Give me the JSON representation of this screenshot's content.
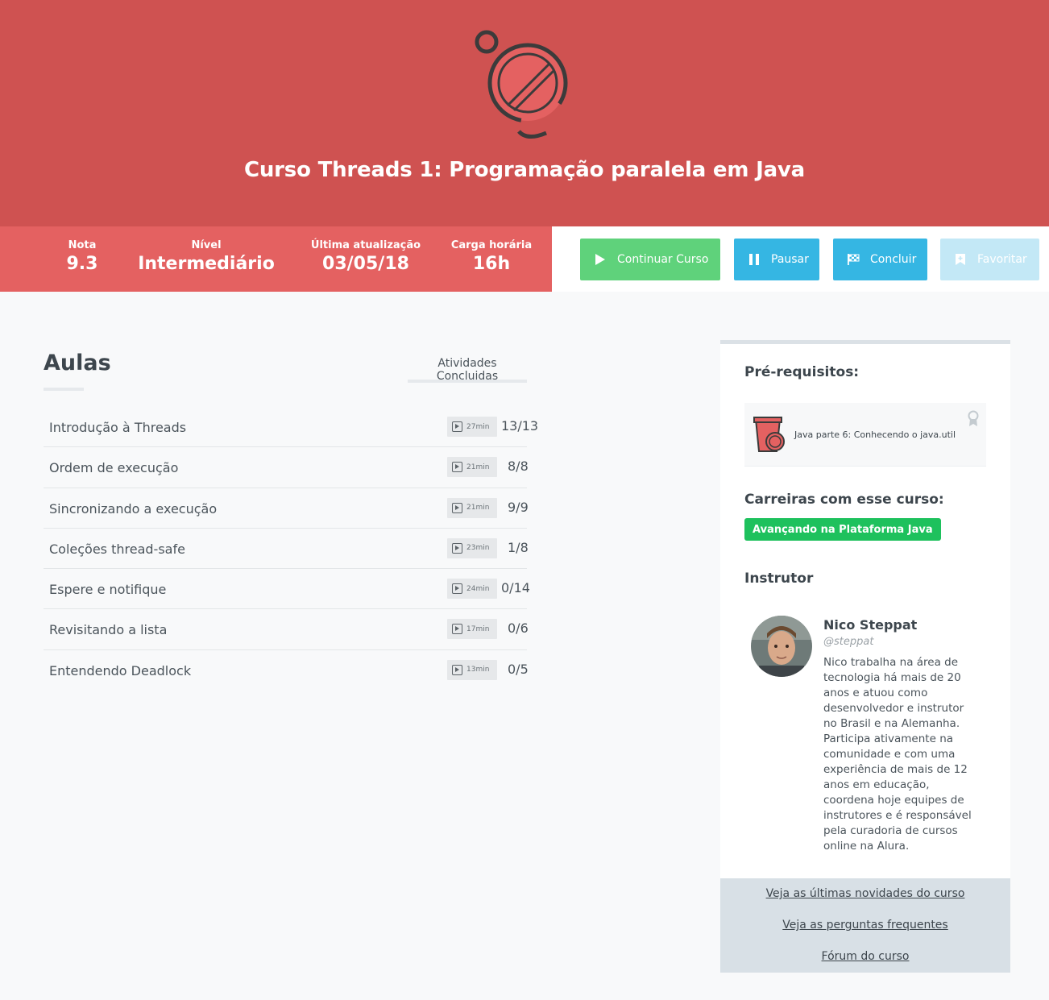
{
  "header": {
    "title": "Curso Threads 1: Programação paralela em Java",
    "logo_icon": "course-threads-icon"
  },
  "stats": {
    "nota": {
      "label": "Nota",
      "value": "9.3"
    },
    "nivel": {
      "label": "Nível",
      "value": "Intermediário"
    },
    "ultima": {
      "label": "Última atualização",
      "value": "03/05/18"
    },
    "carga": {
      "label": "Carga horária",
      "value": "16h"
    }
  },
  "actions": {
    "continuar": "Continuar Curso",
    "pausar": "Pausar",
    "concluir": "Concluir",
    "favoritar": "Favoritar"
  },
  "aulas": {
    "title": "Aulas",
    "activities_label": "Atividades Concluidas",
    "lessons": [
      {
        "name": "Introdução à Threads",
        "duration": "27min",
        "progress": "13/13"
      },
      {
        "name": "Ordem de execução",
        "duration": "21min",
        "progress": "8/8"
      },
      {
        "name": "Sincronizando a execução",
        "duration": "21min",
        "progress": "9/9"
      },
      {
        "name": "Coleções thread-safe",
        "duration": "23min",
        "progress": "1/8"
      },
      {
        "name": "Espere e notifique",
        "duration": "24min",
        "progress": "0/14"
      },
      {
        "name": "Revisitando a lista",
        "duration": "17min",
        "progress": "0/6"
      },
      {
        "name": "Entendendo Deadlock",
        "duration": "13min",
        "progress": "0/5"
      }
    ]
  },
  "sidebar": {
    "prereq_title": "Pré-requisitos:",
    "prereq_course": "Java parte 6: Conhecendo o java.util",
    "careers_title": "Carreiras com esse curso:",
    "career": "Avançando na Plataforma Java",
    "instructor_title": "Instrutor",
    "instructor": {
      "name": "Nico Steppat",
      "handle": "@steppat",
      "bio_lines": [
        "Nico trabalha na área de",
        "tecnologia há mais de 20",
        "anos e atuou como",
        "desenvolvedor e instrutor",
        "no Brasil e na Alemanha.",
        "Participa ativamente na",
        "comunidade e com uma",
        "experiência de mais de 12",
        "anos em educação,",
        "coordena hoje equipes de",
        "instrutores e é responsável",
        "pela curadoria de cursos",
        "online na Alura."
      ]
    },
    "links": [
      "Veja as últimas novidades do curso",
      "Veja as perguntas frequentes",
      "Fórum do curso"
    ]
  },
  "colors": {
    "hero": "#cf5251",
    "stats": "#e46161",
    "continuar": "#5fd27b",
    "blue": "#35b6e3",
    "career": "#1ec15d"
  }
}
